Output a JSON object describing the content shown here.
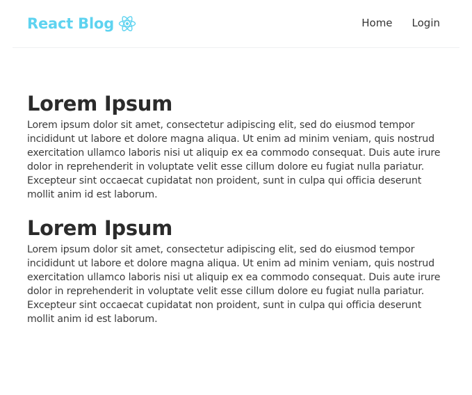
{
  "header": {
    "brand": "React Blog",
    "brand_icon": "react-atom-icon",
    "brand_color": "#5ed3f0",
    "nav": [
      {
        "label": "Home"
      },
      {
        "label": "Login"
      }
    ]
  },
  "posts": [
    {
      "title": "Lorem Ipsum",
      "body": "Lorem ipsum dolor sit amet, consectetur adipiscing elit, sed do eiusmod tempor incididunt ut labore et dolore magna aliqua. Ut enim ad minim veniam, quis nostrud exercitation ullamco laboris nisi ut aliquip ex ea commodo consequat. Duis aute irure dolor in reprehenderit in voluptate velit esse cillum dolore eu fugiat nulla pariatur. Excepteur sint occaecat cupidatat non proident, sunt in culpa qui officia deserunt mollit anim id est laborum."
    },
    {
      "title": "Lorem Ipsum",
      "body": "Lorem ipsum dolor sit amet, consectetur adipiscing elit, sed do eiusmod tempor incididunt ut labore et dolore magna aliqua. Ut enim ad minim veniam, quis nostrud exercitation ullamco laboris nisi ut aliquip ex ea commodo consequat. Duis aute irure dolor in reprehenderit in voluptate velit esse cillum dolore eu fugiat nulla pariatur. Excepteur sint occaecat cupidatat non proident, sunt in culpa qui officia deserunt mollit anim id est laborum."
    }
  ]
}
